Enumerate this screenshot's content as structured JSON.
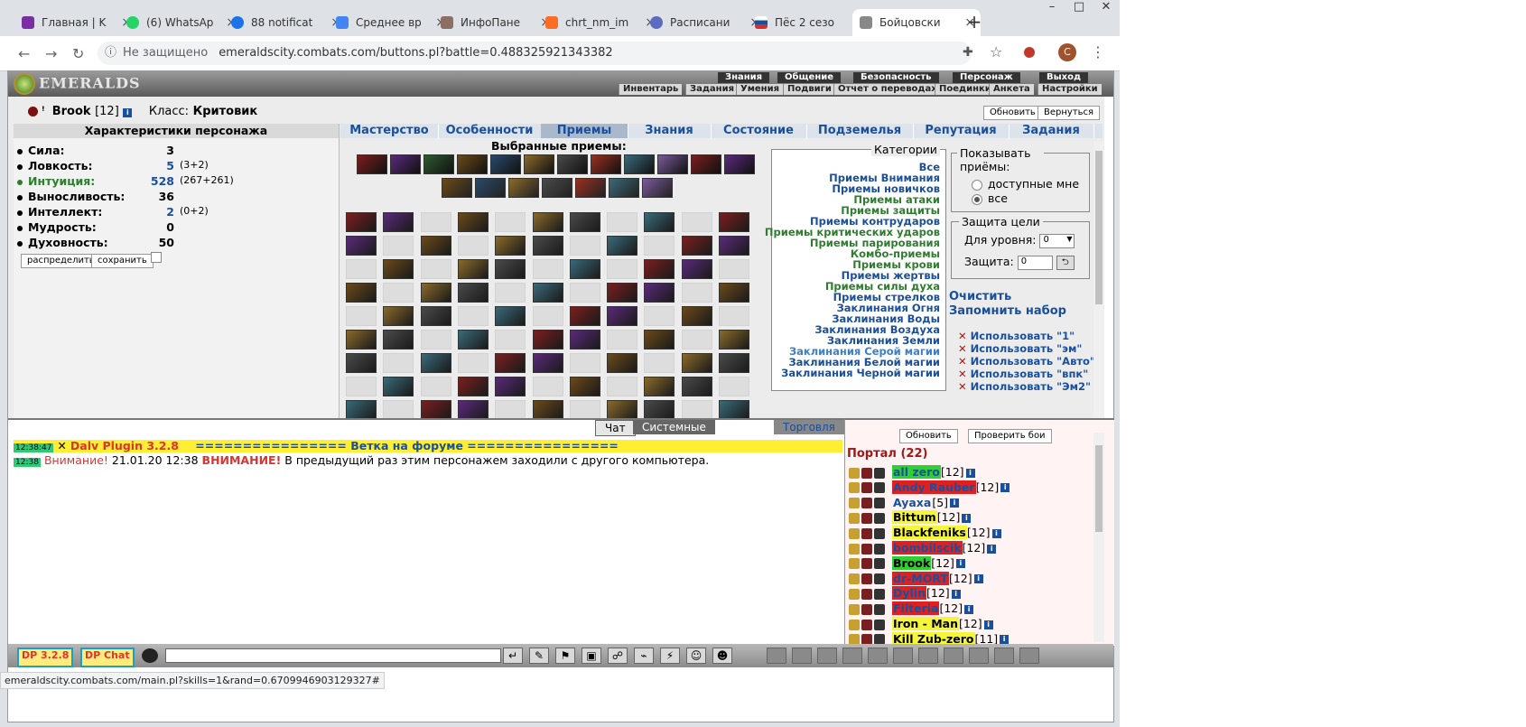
{
  "browser": {
    "tabs": [
      {
        "title": "Главная | K",
        "color": "#7a2ea3"
      },
      {
        "title": "(6) WhatsAp",
        "color": "#25d366"
      },
      {
        "title": "88 notificat",
        "color": "#1a73e8"
      },
      {
        "title": "Среднее вр",
        "color": "#4285f4"
      },
      {
        "title": "ИнфоПане",
        "color": "#8d6e63"
      },
      {
        "title": "chrt_nm_im",
        "color": "#fc6d26"
      },
      {
        "title": "Расписани",
        "color": "#5c6bc0"
      },
      {
        "title": "Пёс 2 сезо",
        "color": "#d32f2f"
      },
      {
        "title": "Бойцовски",
        "color": "#888888"
      }
    ],
    "not_secure": "Не защищено",
    "url": "emeraldscity.combats.com/buttons.pl?battle=0.488325921343382",
    "status_url": "emeraldscity.combats.com/main.pl?skills=1&rand=0.6709946903129327#",
    "profile_initial": "C"
  },
  "game": {
    "logo": "EMERALDS",
    "top_menu": [
      "Знания",
      "Общение",
      "Безопасность",
      "Персонаж",
      "Выход"
    ],
    "sub_menu": [
      "Инвентарь",
      "Задания",
      "Умения",
      "Подвиги",
      "Отчет о переводах",
      "Поединки",
      "Анкета",
      "Настройки"
    ],
    "character": {
      "name": "Brook",
      "level": "[12]",
      "class_label": "Класс:",
      "class_value": "Критовик",
      "refresh": "Обновить",
      "back": "Вернуться"
    },
    "stats_title": "Характеристики персонажа",
    "stats": [
      {
        "label": "Сила:",
        "value": "3",
        "extra": ""
      },
      {
        "label": "Ловкость:",
        "value": "5",
        "extra": "(3+2)"
      },
      {
        "label": "Интуиция:",
        "value": "528",
        "extra": "(267+261)"
      },
      {
        "label": "Выносливость:",
        "value": "36",
        "extra": ""
      },
      {
        "label": "Интеллект:",
        "value": "2",
        "extra": "(0+2)"
      },
      {
        "label": "Мудрость:",
        "value": "0",
        "extra": ""
      },
      {
        "label": "Духовность:",
        "value": "50",
        "extra": ""
      }
    ],
    "distribute": "распределить",
    "save": "сохранить",
    "tabs": [
      "Мастерство",
      "Особенности",
      "Приемы",
      "Знания",
      "Состояние",
      "Подземелья",
      "Репутация",
      "Задания"
    ],
    "active_tab": "Приемы",
    "selected_title": "Выбранные приемы:",
    "categories_title": "Категории",
    "categories": [
      {
        "label": "Все",
        "color": "#1a4f9c"
      },
      {
        "label": "Приемы Внимания",
        "color": "#1a4f9c"
      },
      {
        "label": "Приемы новичков",
        "color": "#1a4f9c"
      },
      {
        "label": "Приемы атаки",
        "color": "#2e7d2e"
      },
      {
        "label": "Приемы защиты",
        "color": "#2e7d2e"
      },
      {
        "label": "Приемы контрударов",
        "color": "#1a4f9c"
      },
      {
        "label": "Приемы критических ударов",
        "color": "#2e7d2e"
      },
      {
        "label": "Приемы парирования",
        "color": "#2e7d2e"
      },
      {
        "label": "Комбо-приемы",
        "color": "#2e7d2e"
      },
      {
        "label": "Приемы крови",
        "color": "#2e7d2e"
      },
      {
        "label": "Приемы жертвы",
        "color": "#1a4f9c"
      },
      {
        "label": "Приемы силы духа",
        "color": "#2e7d2e"
      },
      {
        "label": "Приемы стрелков",
        "color": "#1a4f9c"
      },
      {
        "label": "Заклинания Огня",
        "color": "#1a4f9c"
      },
      {
        "label": "Заклинания Воды",
        "color": "#1a4f9c"
      },
      {
        "label": "Заклинания Воздуха",
        "color": "#1a4f9c"
      },
      {
        "label": "Заклинания Земли",
        "color": "#1a4f9c"
      },
      {
        "label": "Заклинания Серой магии",
        "color": "#3c7dd1"
      },
      {
        "label": "Заклинания Белой магии",
        "color": "#1a4f9c"
      },
      {
        "label": "Заклинания Черной магии",
        "color": "#1a4f9c"
      }
    ],
    "show_title": "Показывать приёмы:",
    "show_options": [
      "доступные мне",
      "все"
    ],
    "protection_title": "Защита цели",
    "for_level_label": "Для уровня:",
    "for_level_value": "0",
    "protection_label": "Защита:",
    "protection_value": "0",
    "clear": "Очистить",
    "remember": "Запомнить набор",
    "use_sets": [
      "Использовать \"1\"",
      "Использовать \"эм\"",
      "Использовать \"Авто\"",
      "Использовать \"впк\"",
      "Использовать \"Эм2\""
    ]
  },
  "chat": {
    "tabs": [
      "Чат",
      "Системные сообщения",
      "Торговля"
    ],
    "line1_time": "12:38:47",
    "line1_text": "Dalv Plugin 3.2.8",
    "line1_link": "================ Ветка на форуме ================",
    "line2_time": "12:38",
    "line2_warn": "Внимание!",
    "line2_date": "21.01.20 12:38",
    "line2_caps": "ВНИМАНИЕ!",
    "line2_text": "В предыдущий раз этим персонажем заходили с другого компьютера."
  },
  "players": {
    "refresh": "Обновить",
    "check": "Проверить бои",
    "location": "Портал (22)",
    "list": [
      {
        "name": "all zero",
        "level": "[12]",
        "bg": "#2fd12f",
        "fg": "#1a4f9c"
      },
      {
        "name": "Andy Rauber",
        "level": "[12]",
        "bg": "#e02020",
        "fg": "#1a4f9c"
      },
      {
        "name": "Ayaxa",
        "level": "[5]",
        "bg": "transparent",
        "fg": "#1a4f9c"
      },
      {
        "name": "Bittum",
        "level": "[12]",
        "bg": "#f5f53a",
        "fg": "#000000"
      },
      {
        "name": "Blackfeniks",
        "level": "[12]",
        "bg": "#f5f53a",
        "fg": "#000000"
      },
      {
        "name": "bombilscik",
        "level": "[12]",
        "bg": "#e02020",
        "fg": "#1a4f9c"
      },
      {
        "name": "Brook",
        "level": "[12]",
        "bg": "#2fd12f",
        "fg": "#000000"
      },
      {
        "name": "dr-MORT",
        "level": "[12]",
        "bg": "#e02020",
        "fg": "#1a4f9c"
      },
      {
        "name": "Dylin",
        "level": "[12]",
        "bg": "#e02020",
        "fg": "#1a4f9c"
      },
      {
        "name": "Filteria",
        "level": "[12]",
        "bg": "#e02020",
        "fg": "#1a4f9c"
      },
      {
        "name": "Iron - Man",
        "level": "[12]",
        "bg": "#f5f53a",
        "fg": "#000000"
      },
      {
        "name": "Kill Zub-zero",
        "level": "[11]",
        "bg": "#f5f53a",
        "fg": "#000000"
      }
    ]
  },
  "bottom": {
    "plugin1": "DP 3.2.8",
    "plugin2": "DP Chat"
  }
}
